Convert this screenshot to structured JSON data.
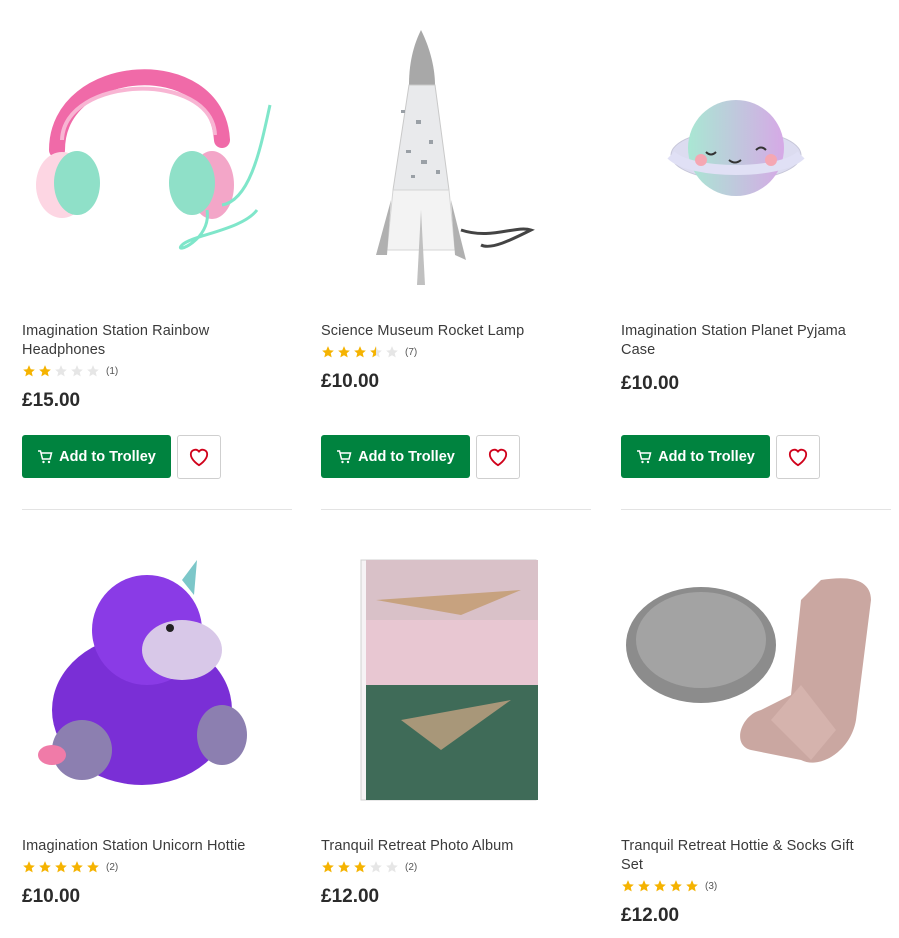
{
  "products": [
    {
      "title_line1": "Imagination Station Rainbow",
      "title_line2": "Headphones",
      "rating": 2,
      "review_count": "(1)",
      "price": "£15.00",
      "button_label": "Add to Trolley",
      "colors": {
        "accent": "#00833f",
        "star": "#f5b301",
        "heart": "#d0021b"
      }
    },
    {
      "title_line1": "Science Museum Rocket Lamp",
      "title_line2": "",
      "rating": 3.5,
      "review_count": "(7)",
      "price": "£10.00",
      "button_label": "Add to Trolley"
    },
    {
      "title_line1": "Imagination Station Planet Pyjama",
      "title_line2": "Case",
      "rating": null,
      "review_count": "",
      "price": "£10.00",
      "button_label": "Add to Trolley"
    },
    {
      "title_line1": "Imagination Station Unicorn Hottie",
      "title_line2": "",
      "rating": 5,
      "review_count": "(2)",
      "price": "£10.00",
      "button_label": ""
    },
    {
      "title_line1": "Tranquil Retreat Photo Album",
      "title_line2": "",
      "rating": 3,
      "review_count": "(2)",
      "price": "£12.00",
      "button_label": ""
    },
    {
      "title_line1": "Tranquil Retreat Hottie & Socks Gift",
      "title_line2": "Set",
      "rating": 5,
      "review_count": "(3)",
      "price": "£12.00",
      "button_label": ""
    }
  ],
  "icons": {
    "cart": "trolley-icon",
    "wishlist": "heart-icon",
    "star": "star-icon"
  }
}
